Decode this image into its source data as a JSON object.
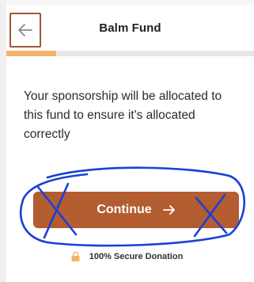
{
  "header": {
    "back_icon": "arrow-left-icon",
    "title": "Balm Fund"
  },
  "progress": {
    "fraction": 0.2
  },
  "message": "Your sponsorship will be allocated to this fund to ensure it's allocated correctly",
  "continue_button": {
    "label": "Continue",
    "icon": "arrow-right-icon"
  },
  "secure_note": {
    "icon": "lock-icon",
    "text": "100% Secure Donation"
  },
  "colors": {
    "accent": "#b35d31",
    "progress_fill": "#f2b36a",
    "back_outline": "#9b5b3c",
    "scribble": "#1c3fd6"
  }
}
